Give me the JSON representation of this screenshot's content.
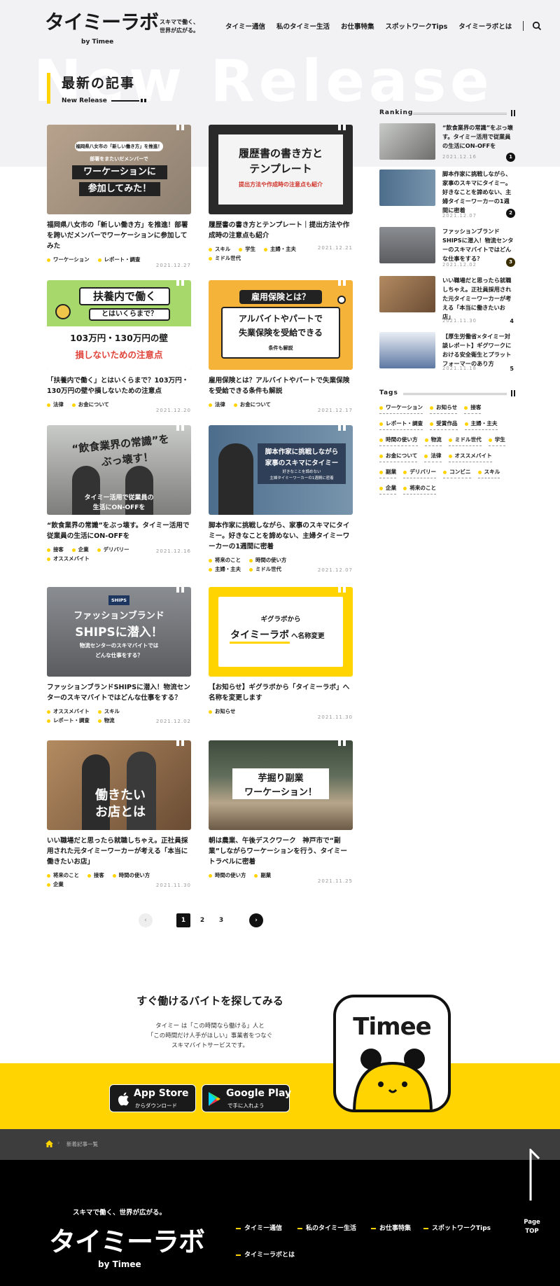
{
  "header": {
    "logo_main": "タイミーラボ",
    "logo_sub": "by Timee",
    "tagline_line1": "スキマで働く、",
    "tagline_line2": "世界が広がる。",
    "nav": [
      "タイミー通信",
      "私のタイミー生活",
      "お仕事特集",
      "スポットワークTips",
      "タイミーラボとは"
    ]
  },
  "section": {
    "bg_text": "New Release",
    "title": "最新の記事",
    "subtitle": "New Release"
  },
  "articles": [
    {
      "thumb_lines": [
        "福岡県八女市の「新しい働き方」を推進！",
        "部署をまたいだメンバーで",
        "ワーケーションに",
        "参加してみた！"
      ],
      "title": "福岡県八女市の「新しい働き方」を推進！部署を跨いだメンバーでワーケーションに参加してみた",
      "tags": [
        "ワーケーション",
        "レポート・調査"
      ],
      "date": "2021.12.27"
    },
    {
      "thumb_lines": [
        "履歴書の書き方と",
        "テンプレート",
        "提出方法や作成時の注意点も紹介"
      ],
      "title": "履歴書の書き方とテンプレート｜提出方法や作成時の注意点も紹介",
      "tags": [
        "スキル",
        "学生",
        "主婦・主夫",
        "ミドル世代"
      ],
      "date": "2021.12.21"
    },
    {
      "thumb_lines": [
        "扶養内で働く",
        "とはいくらまで？",
        "103万円・130万円の壁",
        "損しないための注意点"
      ],
      "title": "「扶養内で働く」とはいくらまで？103万円・130万円の壁や損しないための注意点",
      "tags": [
        "法律",
        "お金について"
      ],
      "date": "2021.12.20"
    },
    {
      "thumb_lines": [
        "雇用保険とは？",
        "アルバイトやパートで",
        "失業保険を受給できる",
        "条件も解説"
      ],
      "title": "雇用保険とは？アルバイトやパートで失業保険を受給できる条件も解説",
      "tags": [
        "法律",
        "お金について"
      ],
      "date": "2021.12.17"
    },
    {
      "thumb_lines": [
        "“飲食業界の常識”を",
        "ぶっ壊す！",
        "タイミー活用で従業員の",
        "生活にON-OFFを"
      ],
      "title": "“飲食業界の常識”をぶっ壊す。タイミー活用で従業員の生活にON-OFFを",
      "tags": [
        "接客",
        "企業",
        "デリバリー",
        "オススメバイト"
      ],
      "date": "2021.12.16"
    },
    {
      "thumb_lines": [
        "脚本作家に挑戦しながら",
        "家事のスキマにタイミー",
        "好きなことを諦めない",
        "主婦タイミーワーカーの1週間に密着"
      ],
      "title": "脚本作家に挑戦しながら、家事のスキマにタイミー。好きなことを諦めない、主婦タイミーワーカーの1週間に密着",
      "tags": [
        "将来のこと",
        "時間の使い方",
        "主婦・主夫",
        "ミドル世代"
      ],
      "date": "2021.12.07"
    },
    {
      "thumb_lines": [
        "SHIPS",
        "ファッションブランド",
        "SHIPSに潜入！",
        "物流センターのスキマバイトでは",
        "どんな仕事をする？"
      ],
      "title": "ファッションブランドSHIPSに潜入！物流センターのスキマバイトではどんな仕事をする？",
      "tags": [
        "オススメバイト",
        "スキル",
        "レポート・調査",
        "物流"
      ],
      "date": "2021.12.02"
    },
    {
      "thumb_lines": [
        "ギグラボから",
        "タイミーラボ",
        "へ名称変更"
      ],
      "title": "【お知らせ】ギグラボから「タイミーラボ」へ名称を変更します",
      "tags": [
        "お知らせ"
      ],
      "date": "2021.11.30"
    },
    {
      "thumb_lines": [
        "働きたい",
        "お店とは"
      ],
      "title": "いい職場だと思ったら就職しちゃえ。正社員採用された元タイミーワーカーが考える「本当に働きたいお店」",
      "tags": [
        "将来のこと",
        "接客",
        "時間の使い方",
        "企業"
      ],
      "date": "2021.11.30"
    },
    {
      "thumb_lines": [
        "芋掘り副業",
        "ワーケーション！"
      ],
      "title": "朝は農業、午後デスクワーク　神戸市で“副業”しながらワーケーションを行う、タイミートラベルに密着",
      "tags": [
        "時間の使い方",
        "副業"
      ],
      "date": "2021.11.25"
    }
  ],
  "ranking": {
    "label": "Ranking",
    "items": [
      {
        "title": "“飲食業界の常識”をぶっ壊す。タイミー活用で従業員の生活にON-OFFを",
        "date": "2021.12.16",
        "rank": "1"
      },
      {
        "title": "脚本作家に挑戦しながら、家事のスキマにタイミー。好きなことを諦めない、主婦タイミーワーカーの1週間に密着",
        "date": "2021.12.07",
        "rank": "2"
      },
      {
        "title": "ファッションブランドSHIPSに潜入！物流センターのスキマバイトではどんな仕事をする？",
        "date": "2021.12.02",
        "rank": "3"
      },
      {
        "title": "いい職場だと思ったら就職しちゃえ。正社員採用された元タイミーワーカーが考える「本当に働きたいお店」",
        "date": "2021.11.30",
        "rank": "4"
      },
      {
        "title": "【厚生労働省×タイミー対談レポート】ギグワークにおける安全衛生とプラットフォーマーのあり方",
        "date": "2021.11.18",
        "rank": "5"
      }
    ]
  },
  "tags_section": {
    "label": "Tags",
    "items": [
      "ワーケーション",
      "お知らせ",
      "接客",
      "レポート・調査",
      "受賞作品",
      "主婦・主夫",
      "時間の使い方",
      "物流",
      "ミドル世代",
      "学生",
      "お金について",
      "法律",
      "オススメバイト",
      "副業",
      "デリバリー",
      "コンビニ",
      "スキル",
      "企業",
      "将来のこと"
    ]
  },
  "pagination": {
    "pages": [
      "1",
      "2",
      "3"
    ],
    "current": "1"
  },
  "cta": {
    "title": "すぐ働けるバイトを探してみる",
    "desc_line1": "タイミー は「この時間なら働ける」人と",
    "desc_line2": "「この時間だけ人手がほしい」事業者をつなぐ",
    "desc_line3": "スキマバイトサービスです。",
    "app_store_main": "App Store",
    "app_store_sub": "からダウンロード",
    "google_play_main": "Google Play",
    "google_play_sub": "で手に入れよう",
    "app_icon_text": "Timee"
  },
  "breadcrumb": {
    "current": "新着記事一覧"
  },
  "footer": {
    "tagline": "スキマで働く、世界が広がる。",
    "logo_main": "タイミーラボ",
    "logo_sub": "by Timee",
    "links": [
      "タイミー通信",
      "私のタイミー生活",
      "お仕事特集",
      "スポットワークTips",
      "タイミーラボとは"
    ],
    "pagetop_line1": "Page",
    "pagetop_line2": "TOP"
  },
  "colors": {
    "accent": "#ffd400",
    "dark": "#1a1a1a",
    "footer": "#000000",
    "breadcrumb_bg": "#3d3d3d"
  }
}
